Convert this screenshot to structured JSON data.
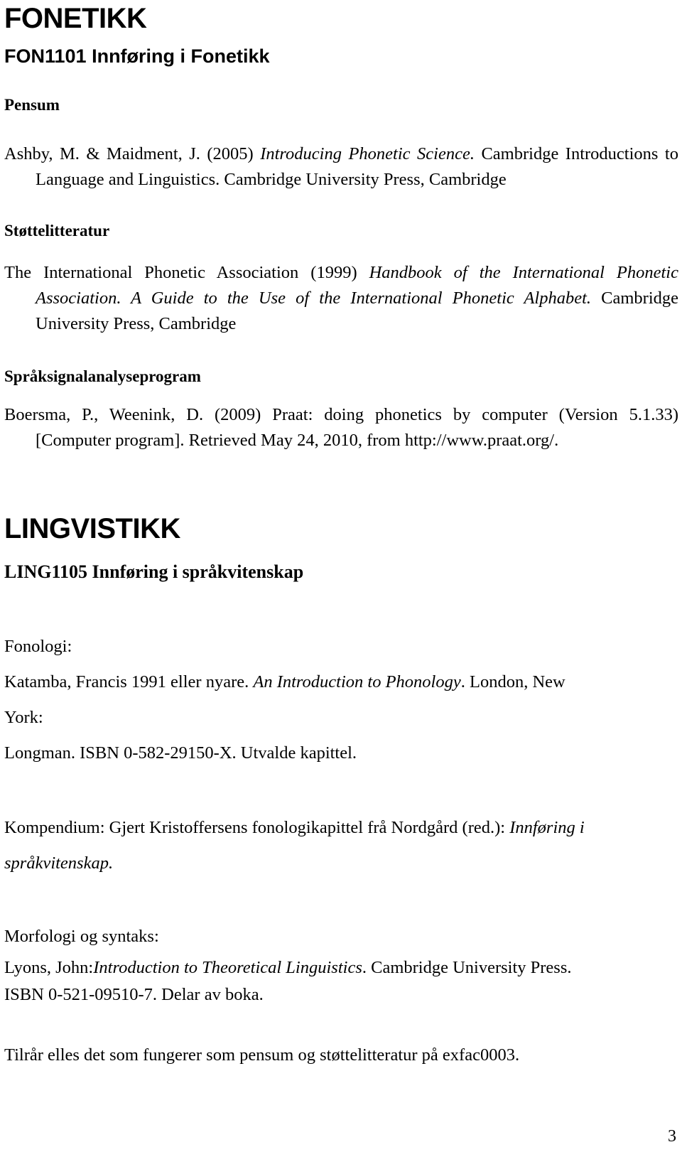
{
  "document": {
    "page_number": "3",
    "sections": [
      {
        "id": "fonetikk",
        "heading": "FONETIKK",
        "course": "FON1101 Innføring i Fonetikk",
        "groups": [
          {
            "label": "Pensum",
            "entries": [
              {
                "line1_plain": "Ashby, M. & Maidment, J. (2005) ",
                "line1_italic": "Introducing Phonetic Science.",
                "line1_tail": " Cambridge Introductions to Language and Linguistics. Cambridge University Press, Cambridge"
              }
            ]
          },
          {
            "label": "Støttelitteratur",
            "entries": [
              {
                "plain_a": "The International Phonetic Association (1999) ",
                "italic_a": "Handbook of the International Phonetic Association. A Guide to the Use of the International Phonetic Alphabet.",
                "tail_a": " Cambridge University Press, Cambridge"
              }
            ]
          },
          {
            "label": "Språksignalanalyseprogram",
            "entries": [
              {
                "text": "Boersma, P., Weenink, D. (2009) Praat: doing phonetics by computer (Version 5.1.33) [Computer program]. Retrieved May 24, 2010, from http://www.praat.org/."
              }
            ]
          }
        ]
      },
      {
        "id": "lingvistikk",
        "heading": "LINGVISTIKK",
        "course": "LING1105 Innføring i språkvitenskap",
        "blocks": [
          {
            "label": "Fonologi:",
            "lines": [
              {
                "plain": "Katamba, Francis 1991 eller nyare. ",
                "italic": "An Introduction to Phonology",
                "tail": ". London, New"
              },
              {
                "plain": "York:"
              },
              {
                "plain": "Longman. ISBN 0-582-29150-X. Utvalde kapittel."
              }
            ]
          },
          {
            "label": null,
            "lines": [
              {
                "plain": "Kompendium: Gjert Kristoffersens fonologikapittel frå Nordgård (red.): ",
                "italic": "Innføring i"
              },
              {
                "italic_only": "språkvitenskap."
              }
            ]
          },
          {
            "label": "Morfologi og syntaks:",
            "lines": [
              {
                "plain": "Lyons, John:",
                "italic": "Introduction to Theoretical Linguistics",
                "tail": ". Cambridge University Press."
              },
              {
                "plain": "ISBN 0-521-09510-7. Delar av boka."
              }
            ]
          },
          {
            "label": null,
            "lines": [
              {
                "plain": "Tilrår elles det som fungerer som pensum og støttelitteratur på exfac0003."
              }
            ]
          }
        ]
      }
    ]
  }
}
